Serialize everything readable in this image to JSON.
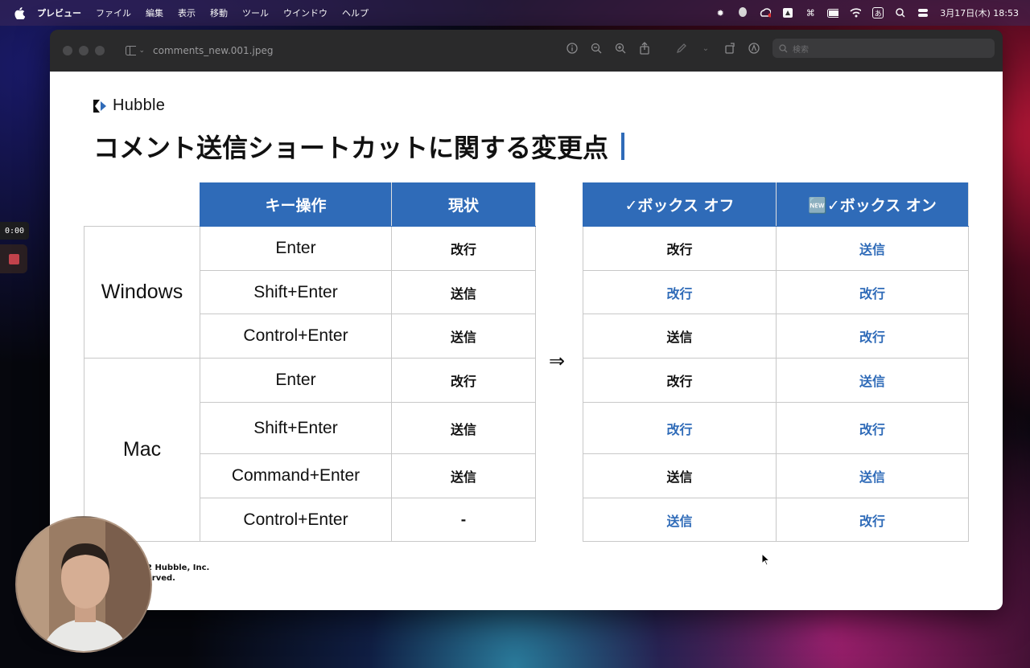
{
  "menubar": {
    "items": [
      "プレビュー",
      "ファイル",
      "編集",
      "表示",
      "移動",
      "ツール",
      "ウインドウ",
      "ヘルプ"
    ],
    "clock": "3月17日(木) 18:53",
    "input_method": "あ"
  },
  "window": {
    "doc_title": "comments_new.001.jpeg",
    "search_placeholder": "検索"
  },
  "slide": {
    "brand": "Hubble",
    "title": "コメント送信ショートカットに関する変更点",
    "arrow": "⇒",
    "copyright_line1": "2 Hubble, Inc.",
    "copyright_line2": "erved.",
    "left_table": {
      "headers": [
        "キー操作",
        "現状"
      ],
      "groups": [
        {
          "os": "Windows",
          "rows": [
            {
              "key": "Enter",
              "current": "改行"
            },
            {
              "key": "Shift+Enter",
              "current": "送信"
            },
            {
              "key": "Control+Enter",
              "current": "送信"
            }
          ]
        },
        {
          "os": "Mac",
          "rows": [
            {
              "key": "Enter",
              "current": "改行"
            },
            {
              "key": "Shift+Enter",
              "current": "送信"
            },
            {
              "key": "Command+Enter",
              "current": "送信"
            },
            {
              "key": "Control+Enter",
              "current": "-"
            }
          ]
        }
      ]
    },
    "right_table": {
      "headers": [
        "✓ボックス オフ",
        "🆕✓ボックス オン"
      ],
      "rows": [
        {
          "off": "改行",
          "on": "送信"
        },
        {
          "off": "改行",
          "on": "改行"
        },
        {
          "off": "送信",
          "on": "改行"
        },
        {
          "off": "改行",
          "on": "送信"
        },
        {
          "off": "改行",
          "on": "改行"
        },
        {
          "off": "送信",
          "on": "送信"
        },
        {
          "off": "送信",
          "on": "改行"
        }
      ]
    }
  },
  "recording": {
    "timer": "0:00"
  },
  "colors": {
    "accent_blue": "#2f6bb8"
  }
}
